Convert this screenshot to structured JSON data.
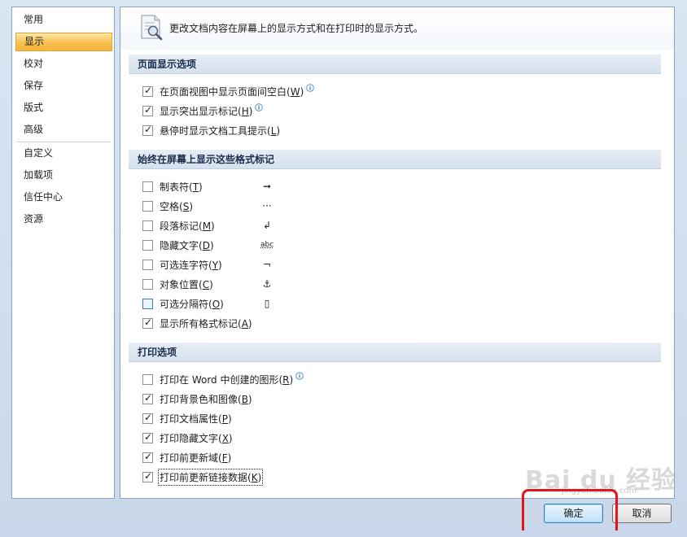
{
  "nav": {
    "items": [
      {
        "label": "常用"
      },
      {
        "label": "显示"
      },
      {
        "label": "校对"
      },
      {
        "label": "保存"
      },
      {
        "label": "版式"
      },
      {
        "label": "高级"
      },
      {
        "label": "自定义"
      },
      {
        "label": "加载项"
      },
      {
        "label": "信任中心"
      },
      {
        "label": "资源"
      }
    ],
    "selected": "显示"
  },
  "header": {
    "text": "更改文档内容在屏幕上的显示方式和在打印时的显示方式。"
  },
  "sections": {
    "page_display": {
      "title": "页面显示选项",
      "options": [
        {
          "label": "在页面视图中显示页面间空白(",
          "key": "W",
          "suffix": ")",
          "checked": true,
          "info": true
        },
        {
          "label": "显示突出显示标记(",
          "key": "H",
          "suffix": ")",
          "checked": true,
          "info": true
        },
        {
          "label": "悬停时显示文档工具提示(",
          "key": "L",
          "suffix": ")",
          "checked": true,
          "info": false
        }
      ]
    },
    "format_marks": {
      "title": "始终在屏幕上显示这些格式标记",
      "options": [
        {
          "label": "制表符(",
          "key": "T",
          "suffix": ")",
          "checked": false,
          "symbol": "➞"
        },
        {
          "label": "空格(",
          "key": "S",
          "suffix": ")",
          "checked": false,
          "symbol": "···"
        },
        {
          "label": "段落标记(",
          "key": "M",
          "suffix": ")",
          "checked": false,
          "symbol": "↲"
        },
        {
          "label": "隐藏文字(",
          "key": "D",
          "suffix": ")",
          "checked": false,
          "symbol": "abc"
        },
        {
          "label": "可选连字符(",
          "key": "Y",
          "suffix": ")",
          "checked": false,
          "symbol": "¬"
        },
        {
          "label": "对象位置(",
          "key": "C",
          "suffix": ")",
          "checked": false,
          "symbol": "⚓"
        },
        {
          "label": "可选分隔符(",
          "key": "O",
          "suffix": ")",
          "checked": false,
          "symbol": "▯"
        },
        {
          "label": "显示所有格式标记(",
          "key": "A",
          "suffix": ")",
          "checked": true,
          "symbol": ""
        }
      ]
    },
    "print": {
      "title": "打印选项",
      "options": [
        {
          "label": "打印在 Word 中创建的图形(",
          "key": "R",
          "suffix": ")",
          "checked": false,
          "info": true
        },
        {
          "label": "打印背景色和图像(",
          "key": "B",
          "suffix": ")",
          "checked": true,
          "info": false
        },
        {
          "label": "打印文档属性(",
          "key": "P",
          "suffix": ")",
          "checked": true,
          "info": false
        },
        {
          "label": "打印隐藏文字(",
          "key": "X",
          "suffix": ")",
          "checked": true,
          "info": false
        },
        {
          "label": "打印前更新域(",
          "key": "F",
          "suffix": ")",
          "checked": true,
          "info": false
        },
        {
          "label": "打印前更新链接数据(",
          "key": "K",
          "suffix": ")",
          "checked": true,
          "info": false
        }
      ]
    }
  },
  "buttons": {
    "ok": "确定",
    "cancel": "取消"
  },
  "watermark": {
    "text": "Bai du 经验",
    "sub": "jingyan.baidu.com"
  },
  "icons": {
    "header": "document-magnifier-icon",
    "info": "info-icon"
  },
  "colors": {
    "selected_nav": "#f9c04f",
    "annotation": "#e8141c"
  }
}
